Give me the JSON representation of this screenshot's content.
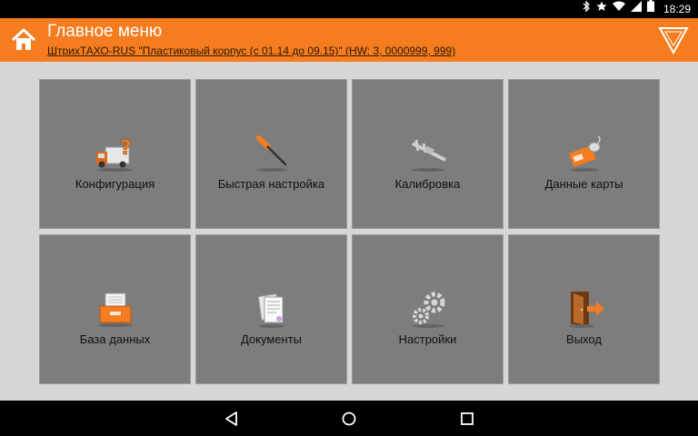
{
  "status_bar": {
    "icons": [
      "bluetooth-icon",
      "star-icon",
      "wifi-icon",
      "signal-icon",
      "battery-icon"
    ],
    "time": "18:29"
  },
  "header": {
    "title": "Главное меню",
    "subtitle": "ШтрихТАХО-RUS \"Пластиковый корпус (с 01.14 до 09.15)\" (HW: 3, 0000999, 999)",
    "accent_color": "#f57c1f"
  },
  "tiles": [
    {
      "label": "Конфигурация",
      "icon": "truck-question-icon"
    },
    {
      "label": "Быстрая настройка",
      "icon": "screwdriver-icon"
    },
    {
      "label": "Калибровка",
      "icon": "caliper-icon"
    },
    {
      "label": "Данные карты",
      "icon": "card-mouse-icon"
    },
    {
      "label": "База данных",
      "icon": "database-drawer-icon"
    },
    {
      "label": "Документы",
      "icon": "documents-icon"
    },
    {
      "label": "Настройки",
      "icon": "gears-icon"
    },
    {
      "label": "Выход",
      "icon": "exit-door-icon"
    }
  ],
  "nav_bar": {
    "buttons": [
      "back-icon",
      "home-circle-icon",
      "recents-icon"
    ]
  }
}
